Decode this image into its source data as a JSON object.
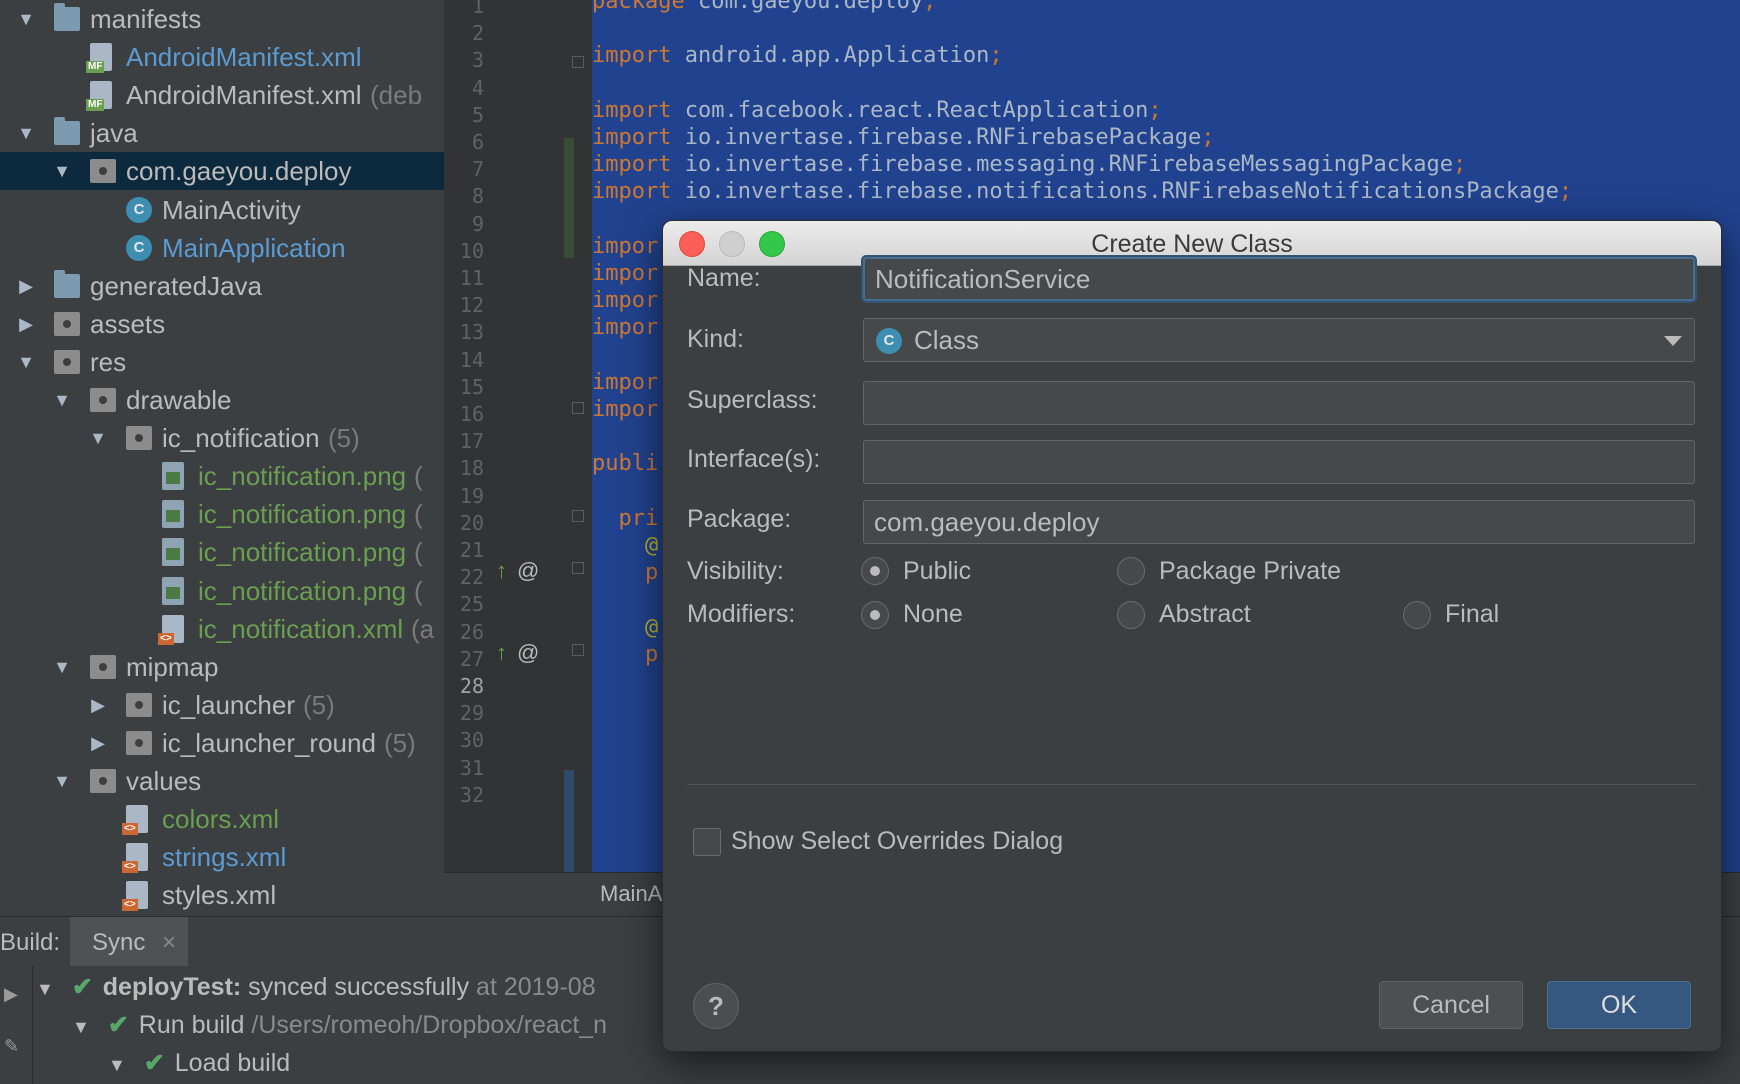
{
  "tree": {
    "items": [
      {
        "label": "manifests",
        "suffix": "",
        "color": "c-def",
        "arrow": "▼",
        "icon": "folder"
      },
      {
        "label": "AndroidManifest.xml",
        "suffix": "",
        "color": "c-blue",
        "arrow": "",
        "icon": "manifest"
      },
      {
        "label": "AndroidManifest.xml",
        "suffix": "(deb",
        "color": "c-def",
        "arrow": "",
        "icon": "manifest"
      },
      {
        "label": "java",
        "suffix": "",
        "color": "c-def",
        "arrow": "▼",
        "icon": "folder"
      },
      {
        "label": "com.gaeyou.deploy",
        "suffix": "",
        "color": "c-def",
        "arrow": "▼",
        "icon": "package"
      },
      {
        "label": "MainActivity",
        "suffix": "",
        "color": "c-def",
        "arrow": "",
        "icon": "class"
      },
      {
        "label": "MainApplication",
        "suffix": "",
        "color": "c-blue",
        "arrow": "",
        "icon": "class"
      },
      {
        "label": "generatedJava",
        "suffix": "",
        "color": "c-def",
        "arrow": "▶",
        "icon": "folder"
      },
      {
        "label": "assets",
        "suffix": "",
        "color": "c-def",
        "arrow": "▶",
        "icon": "resfolder"
      },
      {
        "label": "res",
        "suffix": "",
        "color": "c-def",
        "arrow": "▼",
        "icon": "resfolder"
      },
      {
        "label": "drawable",
        "suffix": "",
        "color": "c-def",
        "arrow": "▼",
        "icon": "package"
      },
      {
        "label": "ic_notification",
        "suffix": "(5)",
        "color": "c-def",
        "arrow": "▼",
        "icon": "package"
      },
      {
        "label": "ic_notification.png",
        "suffix": "(",
        "color": "c-green",
        "arrow": "",
        "icon": "image"
      },
      {
        "label": "ic_notification.png",
        "suffix": "(",
        "color": "c-green",
        "arrow": "",
        "icon": "image"
      },
      {
        "label": "ic_notification.png",
        "suffix": "(",
        "color": "c-green",
        "arrow": "",
        "icon": "image"
      },
      {
        "label": "ic_notification.png",
        "suffix": "(",
        "color": "c-green",
        "arrow": "",
        "icon": "image"
      },
      {
        "label": "ic_notification.xml",
        "suffix": "(a",
        "color": "c-green",
        "arrow": "",
        "icon": "xml"
      },
      {
        "label": "mipmap",
        "suffix": "",
        "color": "c-def",
        "arrow": "▼",
        "icon": "package"
      },
      {
        "label": "ic_launcher",
        "suffix": "(5)",
        "color": "c-def",
        "arrow": "▶",
        "icon": "package"
      },
      {
        "label": "ic_launcher_round",
        "suffix": "(5)",
        "color": "c-def",
        "arrow": "▶",
        "icon": "package"
      },
      {
        "label": "values",
        "suffix": "",
        "color": "c-def",
        "arrow": "▼",
        "icon": "package"
      },
      {
        "label": "colors.xml",
        "suffix": "",
        "color": "c-green",
        "arrow": "",
        "icon": "xml"
      },
      {
        "label": "strings.xml",
        "suffix": "",
        "color": "c-blue",
        "arrow": "",
        "icon": "xml"
      },
      {
        "label": "styles.xml",
        "suffix": "",
        "color": "c-def",
        "arrow": "",
        "icon": "xml"
      }
    ]
  },
  "editor": {
    "line_numbers": [
      "1",
      "2",
      "3",
      "4",
      "5",
      "6",
      "7",
      "8",
      "9",
      "10",
      "11",
      "12",
      "13",
      "14",
      "15",
      "16",
      "17",
      "18",
      "19",
      "20",
      "21",
      "22",
      "25",
      "26",
      "27",
      "28",
      "29",
      "30",
      "31",
      "32"
    ],
    "lines": [
      {
        "kw": "package",
        "rest": " com.gaeyou.deploy",
        "end": ";"
      },
      {
        "kw": "",
        "rest": "",
        "end": ""
      },
      {
        "kw": "import",
        "rest": " android.app.Application",
        "end": ";"
      },
      {
        "kw": "",
        "rest": "",
        "end": ""
      },
      {
        "kw": "import",
        "rest": " com.facebook.react.ReactApplication",
        "end": ";"
      },
      {
        "kw": "import",
        "rest": " io.invertase.firebase.RNFirebasePackage",
        "end": ";"
      },
      {
        "kw": "import",
        "rest": " io.invertase.firebase.messaging.RNFirebaseMessagingPackage",
        "end": ";"
      },
      {
        "kw": "import",
        "rest": " io.invertase.firebase.notifications.RNFirebaseNotificationsPackage",
        "end": ";"
      },
      {
        "kw": "",
        "rest": "",
        "end": ""
      },
      {
        "kw": "impor",
        "rest": "",
        "end": ""
      },
      {
        "kw": "impor",
        "rest": "",
        "end": ""
      },
      {
        "kw": "impor",
        "rest": "",
        "end": ""
      },
      {
        "kw": "impor",
        "rest": "",
        "end": ""
      },
      {
        "kw": "",
        "rest": "",
        "end": ""
      },
      {
        "kw": "impor",
        "rest": "",
        "end": ""
      },
      {
        "kw": "impor",
        "rest": "",
        "end": ""
      },
      {
        "kw": "",
        "rest": "",
        "end": ""
      },
      {
        "kw": "publi",
        "rest": "",
        "end": ""
      },
      {
        "kw": "",
        "rest": "",
        "end": ""
      },
      {
        "kw": "  pri",
        "rest": "",
        "end": ""
      },
      {
        "kw": "",
        "rest": "    @",
        "end": ""
      },
      {
        "kw": "    p",
        "rest": "",
        "end": ""
      },
      {
        "kw": "",
        "rest": "",
        "end": ""
      },
      {
        "kw": "",
        "rest": "    @",
        "end": ""
      },
      {
        "kw": "    p",
        "rest": "",
        "end": ""
      }
    ],
    "gutter_marks": [
      "@",
      "@"
    ],
    "tab_label": "MainA"
  },
  "build": {
    "label": "Build:",
    "tab": "Sync",
    "close": "×",
    "rows": [
      {
        "arrow": "▼",
        "bold": "deployTest:",
        "text": " synced successfully",
        "muted": " at 2019-08"
      },
      {
        "arrow": "▼",
        "bold": "",
        "text": "Run build",
        "muted": " /Users/romeoh/Dropbox/react_n"
      },
      {
        "arrow": "▼",
        "bold": "",
        "text": "Load build",
        "muted": ""
      }
    ]
  },
  "dialog": {
    "title": "Create New Class",
    "labels": {
      "name": "Name:",
      "kind": "Kind:",
      "superclass": "Superclass:",
      "interfaces": "Interface(s):",
      "package": "Package:",
      "visibility": "Visibility:",
      "modifiers": "Modifiers:"
    },
    "name_value": "NotificationService",
    "kind_value": "Class",
    "kind_icon": "C",
    "superclass_value": "",
    "interfaces_value": "",
    "package_value": "com.gaeyou.deploy",
    "visibility_options": [
      "Public",
      "Package Private"
    ],
    "visibility_selected": "Public",
    "modifier_options": [
      "None",
      "Abstract",
      "Final"
    ],
    "modifier_selected": "None",
    "show_overrides_label": "Show Select Overrides Dialog",
    "show_overrides_checked": false,
    "help": "?",
    "cancel": "Cancel",
    "ok": "OK"
  },
  "colors": {
    "selection_blue": "#21428f",
    "accent_ok": "#365880",
    "success_green": "#59a869",
    "close_red": "#fc5f57",
    "zoom_green": "#34c84a"
  }
}
